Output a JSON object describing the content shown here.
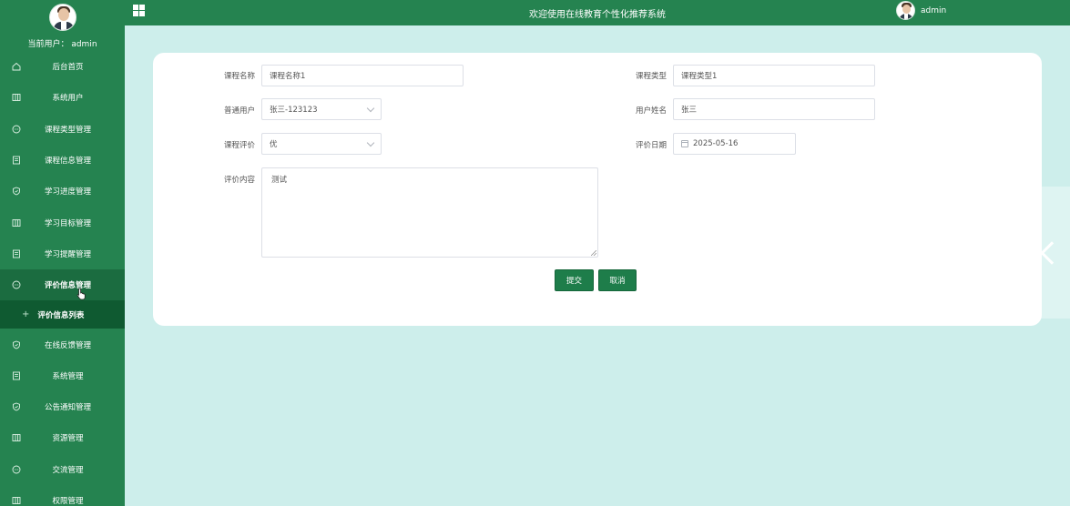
{
  "sidebar": {
    "current_user": "当前用户： admin",
    "items": [
      {
        "label": "后台首页",
        "icon": "home-icon"
      },
      {
        "label": "系统用户",
        "icon": "columns-icon"
      },
      {
        "label": "课程类型管理",
        "icon": "chat-icon"
      },
      {
        "label": "课程信息管理",
        "icon": "document-icon"
      },
      {
        "label": "学习进度管理",
        "icon": "shield-icon"
      },
      {
        "label": "学习目标管理",
        "icon": "columns-icon"
      },
      {
        "label": "学习提醒管理",
        "icon": "document-icon"
      },
      {
        "label": "评价信息管理",
        "icon": "chat-icon",
        "active": true
      },
      {
        "label": "在线反馈管理",
        "icon": "shield-icon"
      },
      {
        "label": "系统管理",
        "icon": "document-icon"
      },
      {
        "label": "公告通知管理",
        "icon": "shield-icon"
      },
      {
        "label": "资源管理",
        "icon": "columns-icon"
      },
      {
        "label": "交流管理",
        "icon": "chat-icon"
      },
      {
        "label": "权限管理",
        "icon": "columns-icon"
      }
    ],
    "submenu_label": "评价信息列表"
  },
  "topbar": {
    "title": "欢迎使用在线教育个性化推荐系统",
    "username": "admin"
  },
  "form": {
    "course_name_label": "课程名称",
    "course_name_value": "课程名称1",
    "course_type_label": "课程类型",
    "course_type_value": "课程类型1",
    "user_label": "普通用户",
    "user_value": "张三-123123",
    "user_name_label": "用户姓名",
    "user_name_value": "张三",
    "rating_label": "课程评价",
    "rating_value": "优",
    "date_label": "评价日期",
    "date_value": "2025-05-16",
    "content_label": "评价内容",
    "content_value": "测试",
    "submit_label": "提交",
    "cancel_label": "取消"
  },
  "colors": {
    "sidebar_bg": "#258350",
    "active_bg": "#1b6c40",
    "submenu_bg": "#0f5a31",
    "page_bg": "#cdeeeb",
    "button_bg": "#1e7d4a"
  }
}
